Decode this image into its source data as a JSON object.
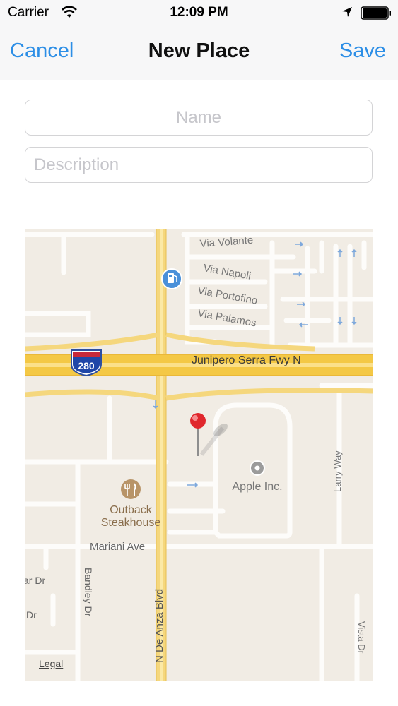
{
  "status_bar": {
    "carrier": "Carrier",
    "time": "12:09 PM",
    "icons": [
      "wifi-icon",
      "location-arrow-icon",
      "battery-icon"
    ]
  },
  "nav_bar": {
    "cancel_label": "Cancel",
    "title": "New Place",
    "save_label": "Save",
    "accent_color": "#2c8ee6"
  },
  "form": {
    "name_placeholder": "Name",
    "name_value": "",
    "description_placeholder": "Description",
    "description_value": ""
  },
  "map": {
    "streets": {
      "via_volante": "Via Volante",
      "via_napoli": "Via Napoli",
      "via_portofino": "Via Portofino",
      "via_palamos": "Via Palamos",
      "freeway": "Junipero Serra Fwy N",
      "mariani": "Mariani Ave",
      "bandley": "Bandley Dr",
      "de_anza": "N De Anza Blvd",
      "larry_way": "Larry Way",
      "vista_dr": "Vista Dr",
      "left_dr_1": "ar Dr",
      "left_dr_2": "Dr"
    },
    "highway_shield": "280",
    "pois": {
      "apple": "Apple Inc.",
      "outback_line1": "Outback",
      "outback_line2": "Steakhouse"
    },
    "legal_label": "Legal",
    "icons": [
      "gas-station-icon",
      "restaurant-icon",
      "apple-poi-icon",
      "red-pin-icon"
    ]
  }
}
